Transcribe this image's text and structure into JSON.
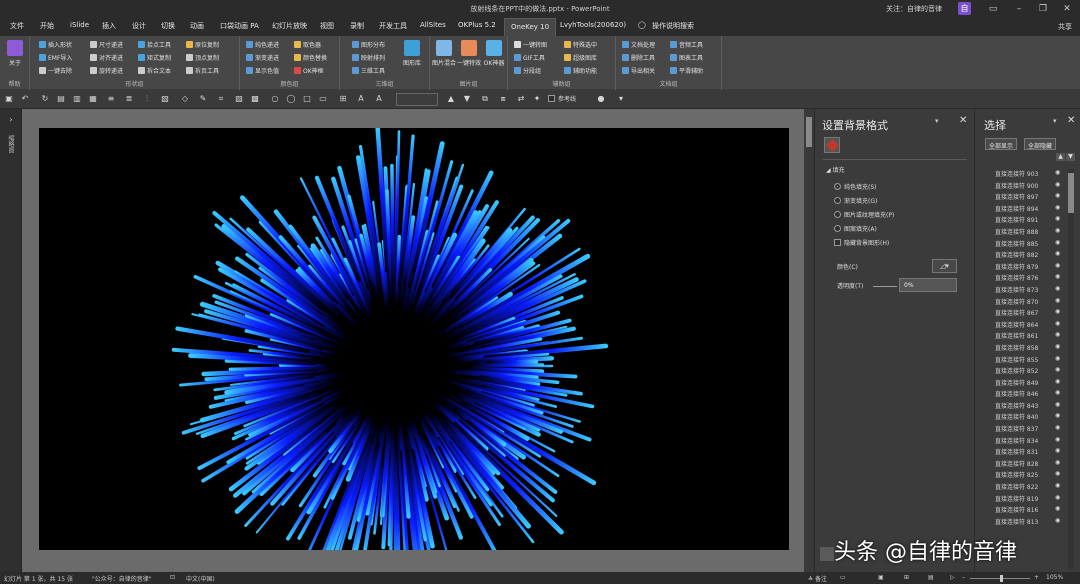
{
  "window": {
    "title": "放射线条在PPT中的做法.pptx - PowerPoint",
    "user": "关注：自律的音律",
    "badge": "自",
    "share": "共享"
  },
  "tabs": [
    "文件",
    "开始",
    "iSlide",
    "插入",
    "设计",
    "切换",
    "动画",
    "口袋动画 PA",
    "幻灯片放映",
    "视图",
    "录制",
    "开发工具",
    "AllSites",
    "OKPlus 5.2",
    "OneKey 10",
    "LvyhTools(200620)",
    "操作说明搜索"
  ],
  "active_tab": "OneKey 10",
  "ribbon": {
    "groups": [
      {
        "label": "帮助",
        "big": "关于"
      },
      {
        "label": "形状组",
        "items": [
          "插入形状",
          "EMF导入",
          "一键去除",
          "尺寸递进",
          "对齐递进",
          "旋转递进",
          "拾点工具",
          "矩式复制",
          "拆合文本",
          "原位复制",
          "顶点复制",
          "拆页工具"
        ]
      },
      {
        "label": "颜色组",
        "items": [
          "纯色递进",
          "渐变递进",
          "显示色值",
          "取色器",
          "颜色替换",
          "OK神框"
        ]
      },
      {
        "label": "三维组",
        "items": [
          "图形分布",
          "映射排列",
          "三维工具"
        ],
        "big": "图形库"
      },
      {
        "label": "图片组",
        "big": [
          "图片混合",
          "一键特效",
          "OK神器"
        ]
      },
      {
        "label": "辅助组",
        "items": [
          "一键转图",
          "GIF工具",
          "分段组",
          "特殊选中",
          "超级图库",
          "辅助功能"
        ]
      },
      {
        "label": "文档组",
        "items": [
          "文档处理",
          "音频工具",
          "删除工具",
          "图表工具",
          "导出相关",
          "平滑辅助"
        ]
      }
    ]
  },
  "qat": {
    "reference_line": "参考线"
  },
  "format_pane": {
    "title": "设置背景格式",
    "section": "填充",
    "options": [
      "纯色填充(S)",
      "渐变填充(G)",
      "图片或纹理填充(P)",
      "图案填充(A)"
    ],
    "selected": "纯色填充(S)",
    "hide_bg": "隐藏背景图形(H)",
    "color_label": "颜色(C)",
    "transparency_label": "透明度(T)",
    "transparency_value": "0%"
  },
  "selection_pane": {
    "title": "选择",
    "show_all": "全部显示",
    "hide_all": "全部隐藏",
    "items": [
      "直接连接符 903",
      "直接连接符 900",
      "直接连接符 897",
      "直接连接符 894",
      "直接连接符 891",
      "直接连接符 888",
      "直接连接符 885",
      "直接连接符 882",
      "直接连接符 879",
      "直接连接符 876",
      "直接连接符 873",
      "直接连接符 870",
      "直接连接符 867",
      "直接连接符 864",
      "直接连接符 861",
      "直接连接符 858",
      "直接连接符 855",
      "直接连接符 852",
      "直接连接符 849",
      "直接连接符 846",
      "直接连接符 843",
      "直接连接符 840",
      "直接连接符 837",
      "直接连接符 834",
      "直接连接符 831",
      "直接连接符 828",
      "直接连接符 825",
      "直接连接符 822",
      "直接连接符 819",
      "直接连接符 816",
      "直接连接符 813"
    ]
  },
  "left_pane": {
    "label": "缩略图"
  },
  "status": {
    "slide": "幻灯片 第 1 张，共 15 张",
    "theme": "\"公众号：自律的音律\"",
    "lang": "中文(中国)",
    "notes": "备注",
    "zoom": "105%"
  },
  "watermark": "头条 @自律的音律",
  "colors": {
    "burst_core": "#0a1cff",
    "burst_tip": "#39c8ff",
    "accent": "#2b2b2b"
  }
}
